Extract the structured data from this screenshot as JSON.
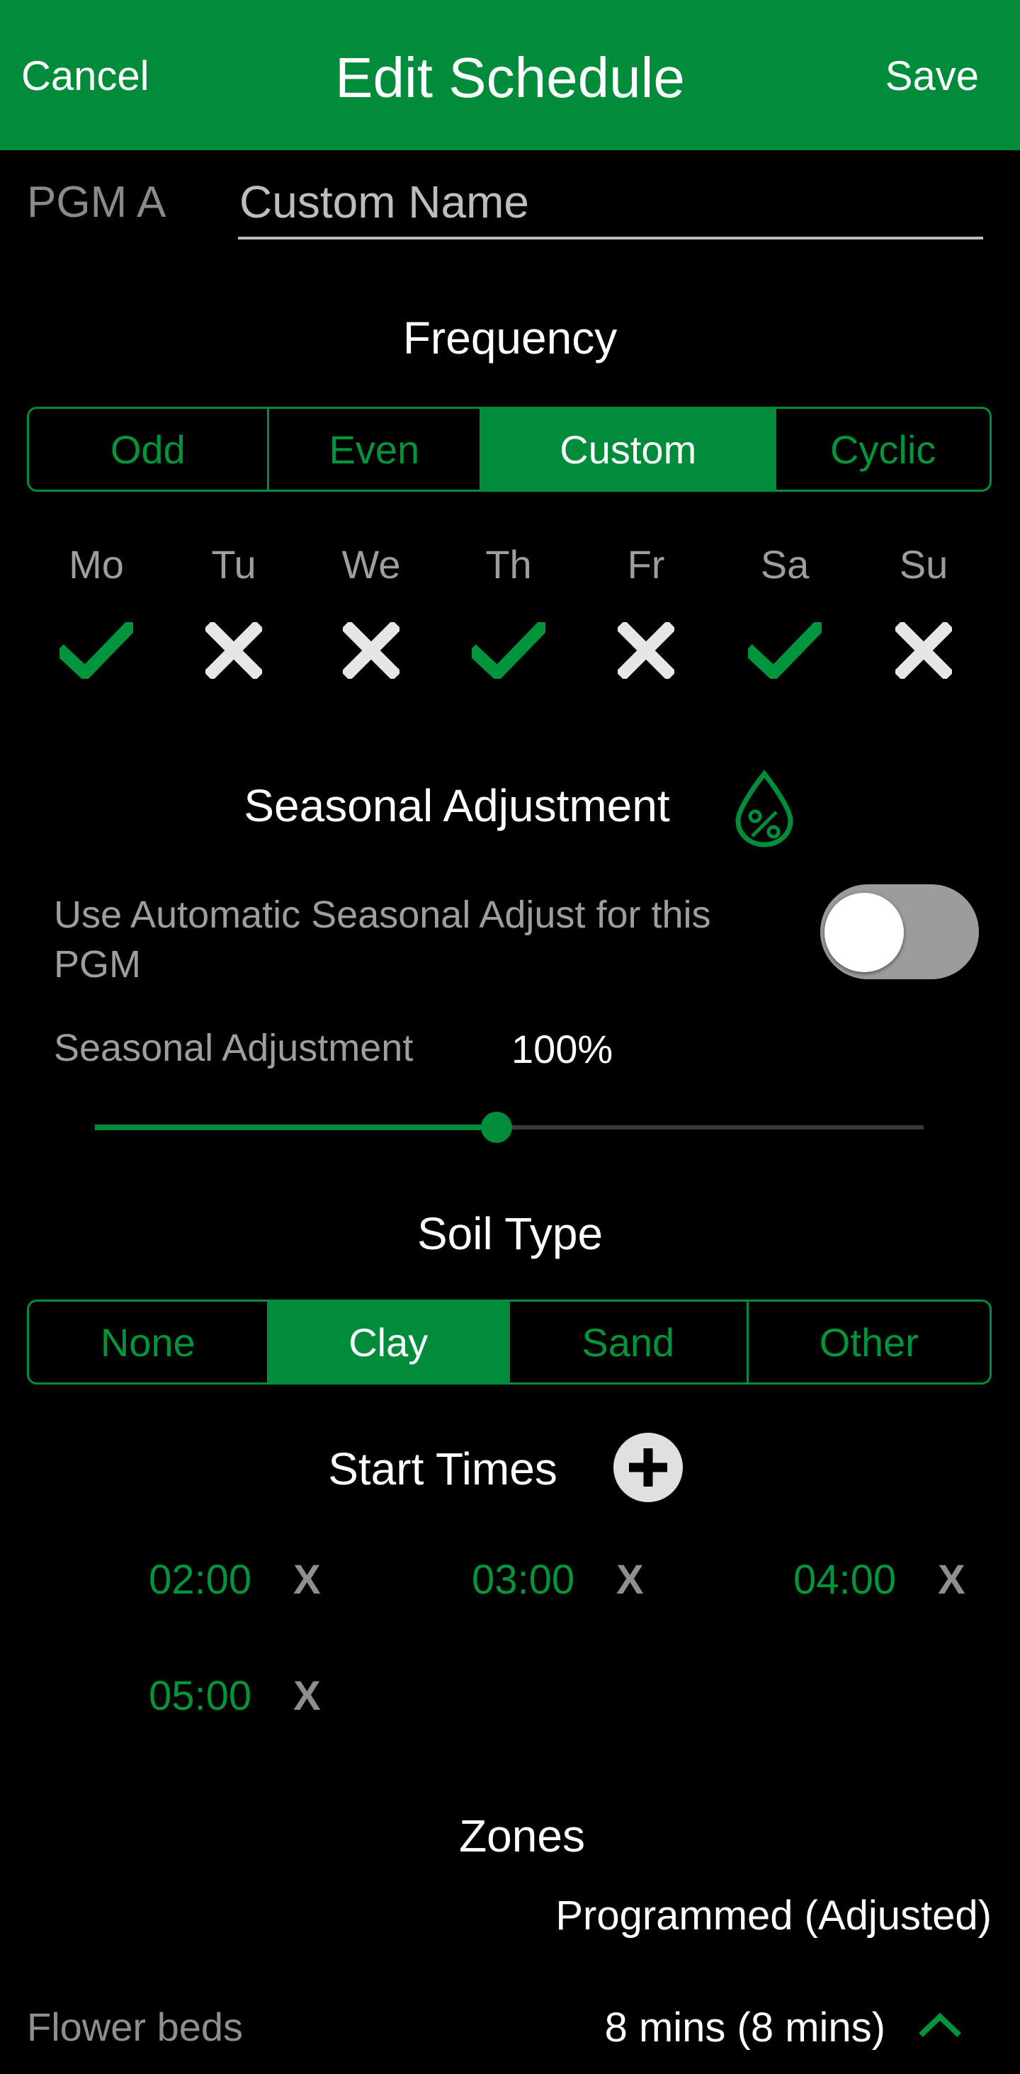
{
  "header": {
    "cancel": "Cancel",
    "title": "Edit Schedule",
    "save": "Save"
  },
  "program": {
    "label": "PGM A",
    "name_placeholder": "Custom Name",
    "name_value": ""
  },
  "frequency": {
    "title": "Frequency",
    "options": [
      "Odd",
      "Even",
      "Custom",
      "Cyclic"
    ],
    "selected": "Custom",
    "days": [
      {
        "label": "Mo",
        "enabled": true
      },
      {
        "label": "Tu",
        "enabled": false
      },
      {
        "label": "We",
        "enabled": false
      },
      {
        "label": "Th",
        "enabled": true
      },
      {
        "label": "Fr",
        "enabled": false
      },
      {
        "label": "Sa",
        "enabled": true
      },
      {
        "label": "Su",
        "enabled": false
      }
    ]
  },
  "seasonal": {
    "title": "Seasonal Adjustment",
    "icon": "droplet-percent-icon",
    "auto_label": "Use Automatic Seasonal Adjust for this PGM",
    "auto_enabled": false,
    "adjust_label": "Seasonal Adjustment",
    "adjust_value": "100%",
    "slider_fraction": 0.485
  },
  "soil": {
    "title": "Soil Type",
    "options": [
      "None",
      "Clay",
      "Sand",
      "Other"
    ],
    "selected": "Clay"
  },
  "start_times": {
    "title": "Start Times",
    "add_icon": "plus-circle-icon",
    "remove_label": "X",
    "times": [
      "02:00",
      "03:00",
      "04:00",
      "05:00"
    ]
  },
  "zones": {
    "title": "Zones",
    "column_header": "Programmed (Adjusted)",
    "items": [
      {
        "name": "Flower beds",
        "duration": "8 mins (8 mins)"
      }
    ]
  },
  "colors": {
    "brand": "#008c3a",
    "background": "#000000",
    "muted_text": "#9e9e9e"
  }
}
